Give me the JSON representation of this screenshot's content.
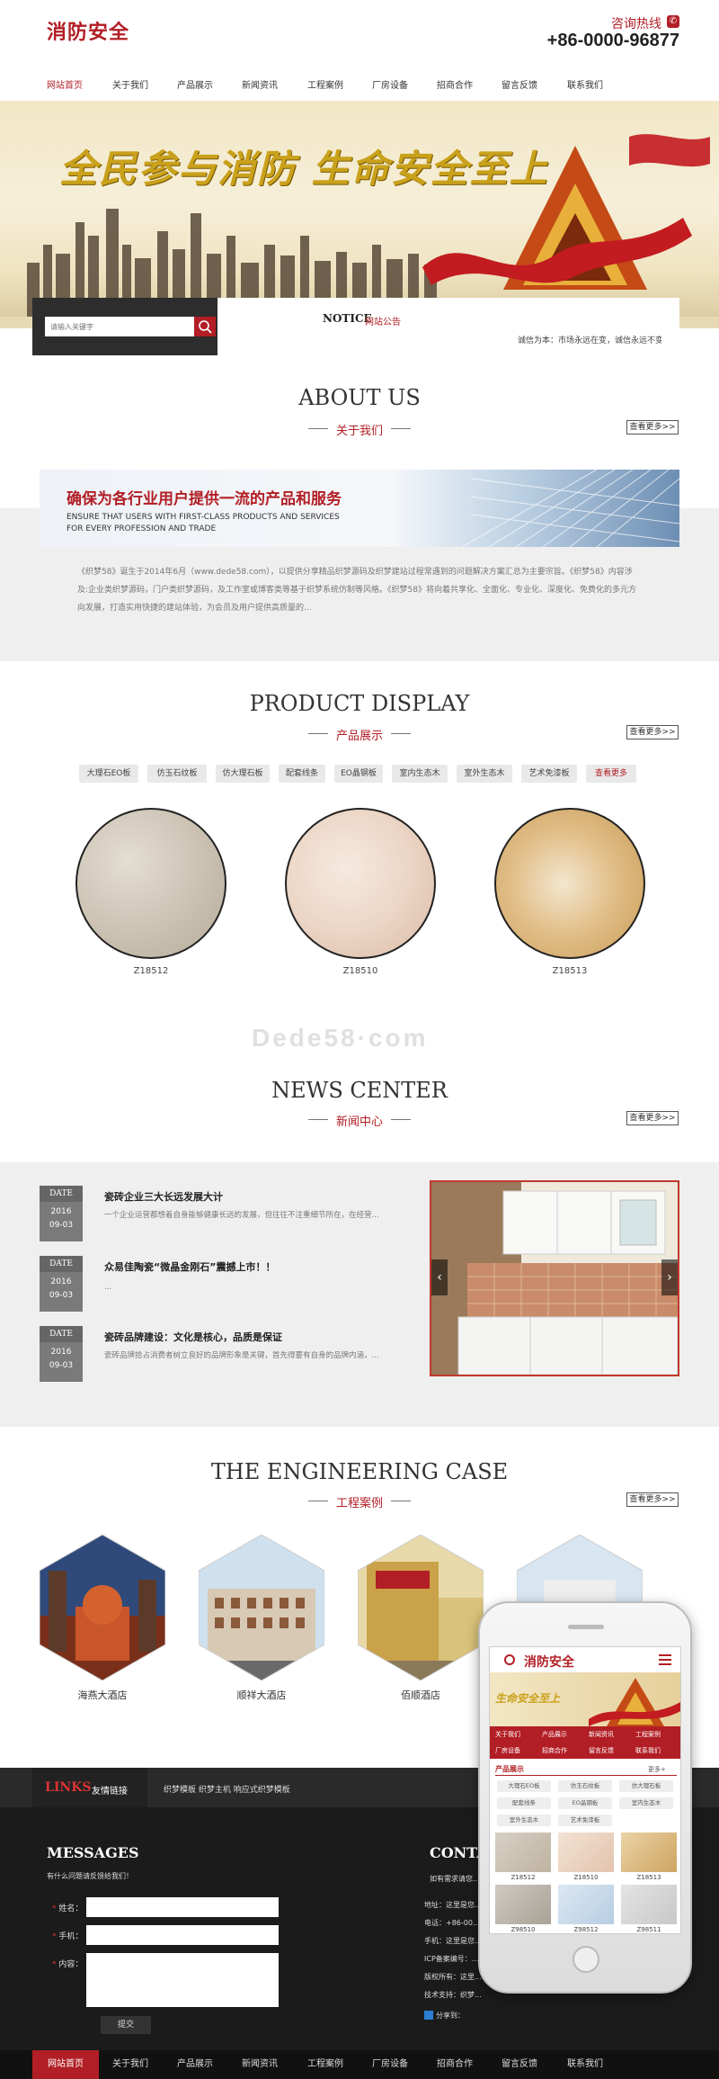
{
  "header": {
    "logo": "消防安全",
    "hotline_label": "咨询热线",
    "hotline_number": "+86-0000-96877"
  },
  "nav": {
    "items": [
      "网站首页",
      "关于我们",
      "产品展示",
      "新闻资讯",
      "工程案例",
      "厂房设备",
      "招商合作",
      "留言反馈",
      "联系我们"
    ],
    "active_index": 0
  },
  "banner": {
    "slogan": "全民参与消防  生命安全至上"
  },
  "search": {
    "placeholder": "请输入关键字"
  },
  "notice": {
    "title": "NOTICE",
    "subtitle": "网站公告",
    "text": "诚信为本：市场永远在变，诚信永远不变"
  },
  "about": {
    "title": "ABOUT US",
    "subtitle": "关于我们",
    "more": "查看更多>>",
    "banner_heading": "确保为各行业用户提供一流的产品和服务",
    "banner_en_1": "ENSURE THAT USERS WITH FIRST-CLASS PRODUCTS AND SERVICES",
    "banner_en_2": "FOR EVERY PROFESSION AND TRADE",
    "body": "《织梦58》诞生于2014年6月（www.dede58.com），以提供分享精品织梦源码及织梦建站过程常遇到的问题解决方案汇总为主要宗旨。《织梦58》内容涉及:企业类织梦源码，门户类织梦源码，及工作室或博客类等基于织梦系统仿制等风格。《织梦58》将向着共享化、全面化、专业化、深度化、免费化的多元方向发展，打造实用快捷的建站体验，为会员及用户提供高质量的..."
  },
  "products": {
    "title": "PRODUCT DISPLAY",
    "subtitle": "产品展示",
    "more": "查看更多>>",
    "tags": [
      "大理石EO板",
      "仿玉石纹板",
      "仿大理石板",
      "配套线条",
      "EO晶钢板",
      "室内生态木",
      "室外生态木",
      "艺术免漆板",
      "查看更多"
    ],
    "items": [
      {
        "code": "Z18512",
        "color": "#cfc6b8"
      },
      {
        "code": "Z18510",
        "color": "#ecd6c6"
      },
      {
        "code": "Z18513",
        "color": "#e2c08b"
      }
    ]
  },
  "watermark": "Dede58·com",
  "news": {
    "title": "NEWS CENTER",
    "subtitle": "新闻中心",
    "more": "查看更多>>",
    "date_label": "DATE",
    "items": [
      {
        "year": "2016",
        "date": "09-03",
        "title": "瓷砖企业三大长远发展大计",
        "desc": "一个企业运营都想着自身能够健康长远的发展，但往往不注重细节所在，在经营..."
      },
      {
        "year": "2016",
        "date": "09-03",
        "title": "众易佳陶瓷“微晶金刚石”震撼上市！！",
        "desc": "..."
      },
      {
        "year": "2016",
        "date": "09-03",
        "title": "瓷砖品牌建设：文化是核心，品质是保证",
        "desc": "瓷砖品牌拾占消费者树立良好的品牌形象是关键，首先得要有自身的品牌内涵，..."
      }
    ]
  },
  "cases": {
    "title": "THE ENGINEERING CASE",
    "subtitle": "工程案例",
    "more": "查看更多>>",
    "items": [
      "海燕大酒店",
      "顺祥大酒店",
      "佰顺酒店"
    ]
  },
  "links": {
    "title": "LINKS",
    "subtitle": "友情链接",
    "text": "织梦模板  织梦主机  响应式织梦模板"
  },
  "messages": {
    "title": "MESSAGES",
    "subtitle": "有什么问题请反馈给我们！",
    "fields": [
      "姓名：",
      "手机：",
      "内容："
    ],
    "submit": "提交"
  },
  "contact": {
    "title": "CONTAC",
    "lines": [
      "如有需求请您...",
      "地址：这里是您...",
      "电话：+86-00...",
      "手机：这里是您...",
      "ICP备案编号：...",
      "版权所有：这里...",
      "技术支持：织梦...",
      "分享到："
    ]
  },
  "phone": {
    "logo": "消防安全",
    "slogan": "生命安全至上",
    "nav": [
      "关于我们",
      "产品展示",
      "新闻资讯",
      "工程案例",
      "厂房设备",
      "招商合作",
      "留言反馈",
      "联系我们"
    ],
    "section": "产品展示",
    "more": "更多+",
    "tags": [
      "大理石EO板",
      "仿玉石纹板",
      "仿大理石板",
      "配套线条",
      "EO晶钢板",
      "室内生态木",
      "室外生态木",
      "艺术免漆板"
    ],
    "items": [
      "Z18512",
      "Z18510",
      "Z18513",
      "Z98510",
      "Z98512",
      "Z98511"
    ]
  },
  "colors": {
    "brand": "#b21e25",
    "dark": "#1b1b1b"
  }
}
